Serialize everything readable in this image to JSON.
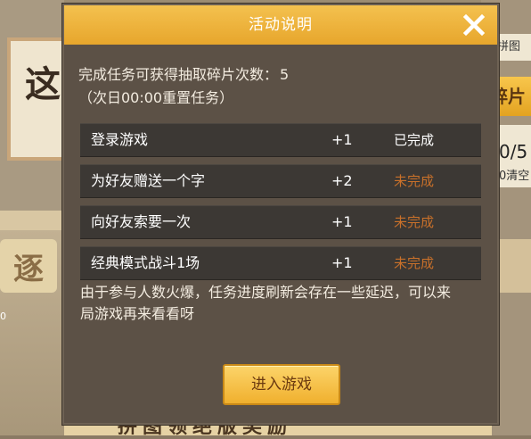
{
  "background": {
    "left_char": "这",
    "left_tile_char": "逐",
    "left_counter": "0",
    "right_pill": "拼图",
    "right_button": "碎片",
    "right_count": "0/5",
    "right_clear": "0清空",
    "bottom_title": "拼图领绝版奖励"
  },
  "dialog": {
    "title": "活动说明",
    "quota_label": "完成任务可获得抽取碎片次数：",
    "quota_value": "5",
    "reset_note": "（次日00:00重置任务）",
    "tasks": [
      {
        "name": "登录游戏",
        "reward": "+1",
        "status": "已完成",
        "completed": true
      },
      {
        "name": "为好友赠送一个字",
        "reward": "+2",
        "status": "未完成",
        "completed": false
      },
      {
        "name": "向好友索要一次",
        "reward": "+1",
        "status": "未完成",
        "completed": false
      },
      {
        "name": "经典模式战斗1场",
        "reward": "+1",
        "status": "未完成",
        "completed": false
      }
    ],
    "notice": "由于参与人数火爆，任务进度刷新会存在一些延迟，可以来局游戏再来看看呀",
    "enter_button": "进入游戏"
  },
  "colors": {
    "header": "#f0b23a",
    "panel": "#5c5146",
    "row": "#3c3834",
    "pending_status": "#c8702a",
    "button": "#f5bf45"
  }
}
